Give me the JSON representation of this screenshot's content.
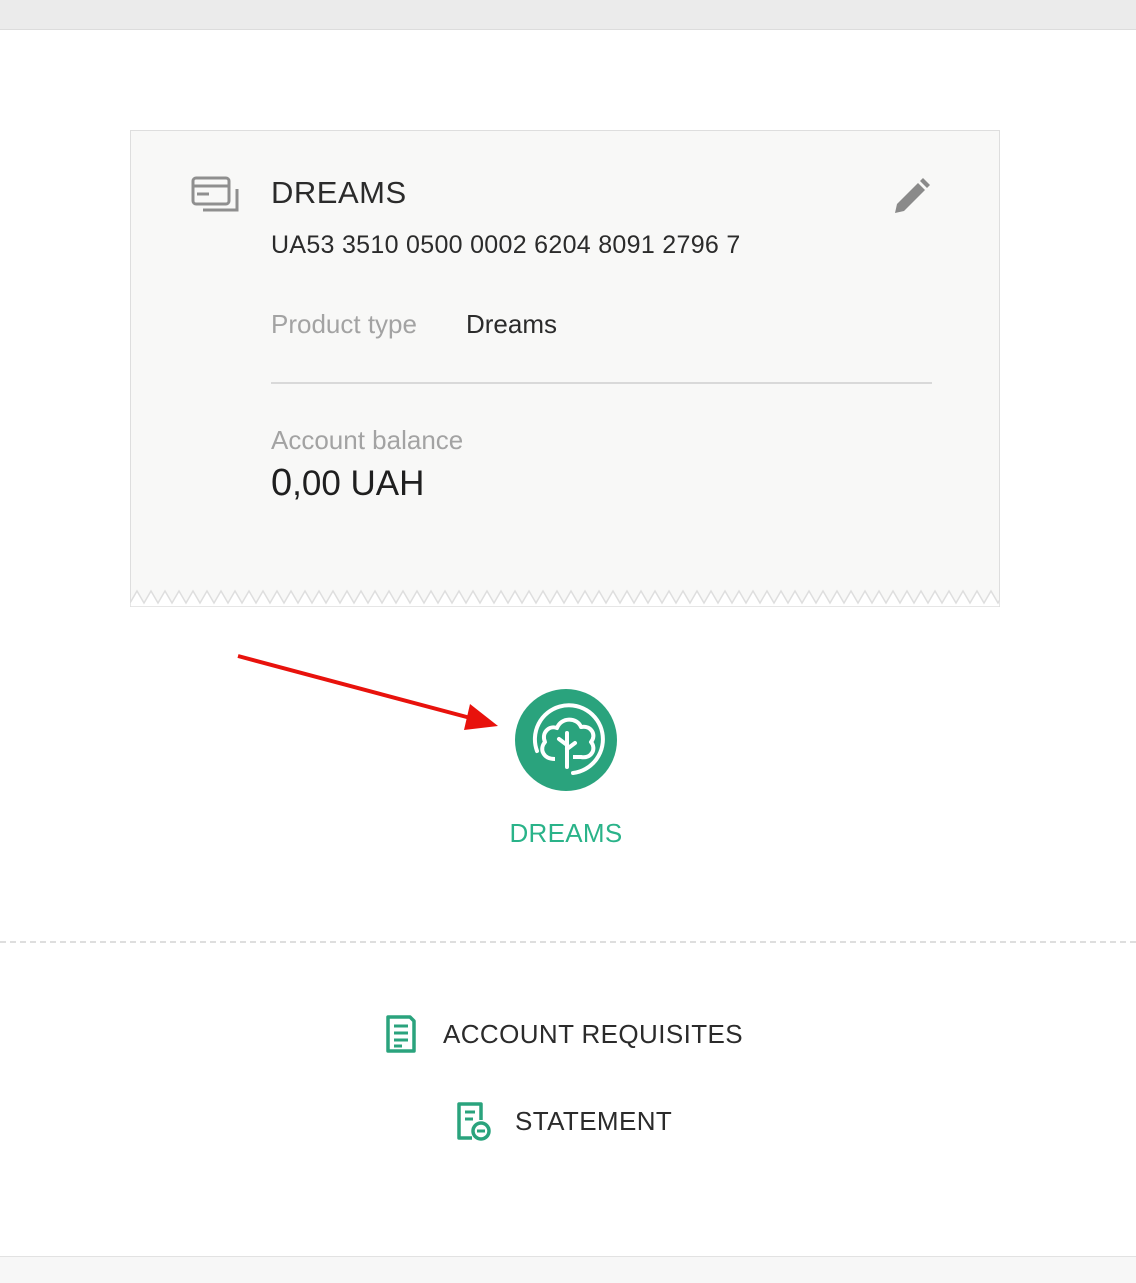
{
  "account": {
    "name": "DREAMS",
    "iban": "UA53 3510 0500 0002 6204 8091 2796 7",
    "product_type_label": "Product type",
    "product_type_value": "Dreams",
    "balance_label": "Account balance",
    "balance_integer": "0",
    "balance_fraction": ",00",
    "currency": "UAH"
  },
  "dreams_button": {
    "label": "DREAMS",
    "icon": "cloud-tree-icon"
  },
  "actions": [
    {
      "label": "ACCOUNT REQUISITES",
      "icon": "document-icon"
    },
    {
      "label": "STATEMENT",
      "icon": "statement-icon"
    }
  ],
  "colors": {
    "accent": "#2aa37d",
    "accent_text": "#2ab389",
    "annotation_arrow": "#e8120c",
    "card_bg": "#f8f8f7"
  }
}
